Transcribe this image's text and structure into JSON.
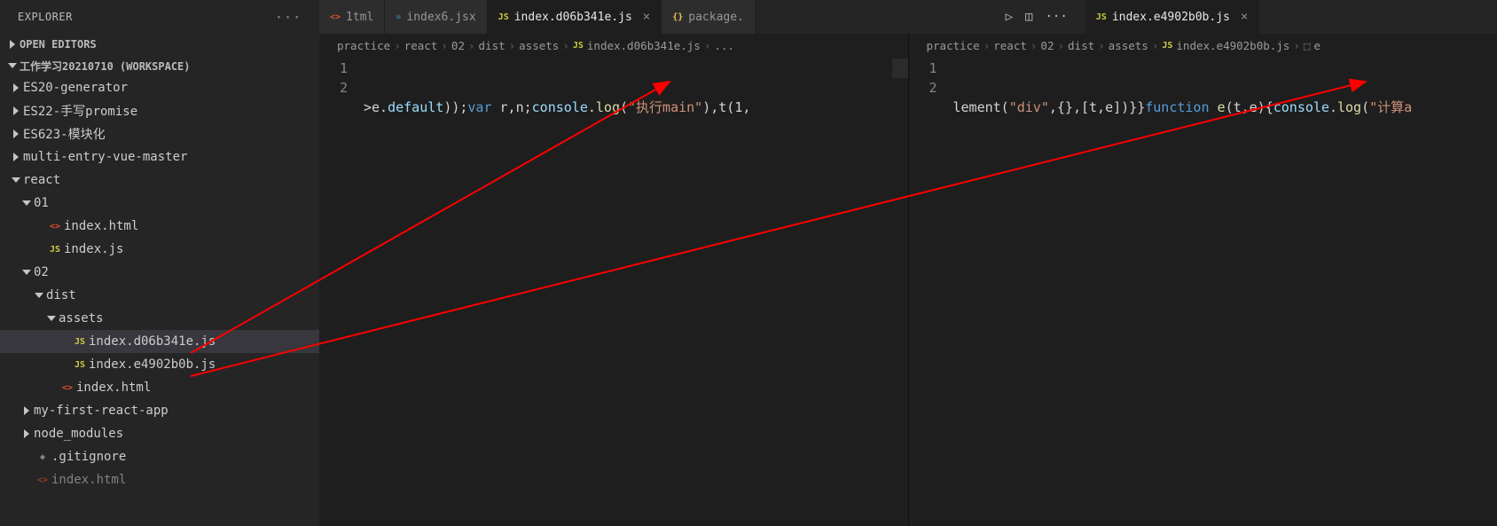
{
  "explorer": {
    "title": "EXPLORER",
    "sections": {
      "open_editors": "OPEN EDITORS",
      "workspace": "工作学习20210710 (WORKSPACE)"
    },
    "tree": [
      {
        "kind": "folder",
        "depth": 1,
        "open": false,
        "label": "ES20-generator"
      },
      {
        "kind": "folder",
        "depth": 1,
        "open": false,
        "label": "ES22-手写promise"
      },
      {
        "kind": "folder",
        "depth": 1,
        "open": false,
        "label": "ES623-模块化"
      },
      {
        "kind": "folder",
        "depth": 1,
        "open": false,
        "label": "multi-entry-vue-master"
      },
      {
        "kind": "folder",
        "depth": 1,
        "open": true,
        "label": "react"
      },
      {
        "kind": "folder",
        "depth": 2,
        "open": true,
        "label": "01"
      },
      {
        "kind": "file",
        "depth": 3,
        "icon": "html",
        "label": "index.html"
      },
      {
        "kind": "file",
        "depth": 3,
        "icon": "js",
        "label": "index.js"
      },
      {
        "kind": "folder",
        "depth": 2,
        "open": true,
        "label": "02"
      },
      {
        "kind": "folder",
        "depth": 3,
        "open": true,
        "label": "dist"
      },
      {
        "kind": "folder",
        "depth": 4,
        "open": true,
        "label": "assets"
      },
      {
        "kind": "file",
        "depth": 5,
        "icon": "js",
        "label": "index.d06b341e.js",
        "selected": true
      },
      {
        "kind": "file",
        "depth": 5,
        "icon": "js",
        "label": "index.e4902b0b.js"
      },
      {
        "kind": "file",
        "depth": 4,
        "icon": "html",
        "label": "index.html"
      },
      {
        "kind": "folder",
        "depth": 2,
        "open": false,
        "label": "my-first-react-app"
      },
      {
        "kind": "folder",
        "depth": 2,
        "open": false,
        "label": "node_modules"
      },
      {
        "kind": "file",
        "depth": 2,
        "icon": "git",
        "label": ".gitignore"
      },
      {
        "kind": "file",
        "depth": 2,
        "icon": "html",
        "label": "index.html",
        "dim": true
      }
    ]
  },
  "tabs": [
    {
      "icon": "html",
      "label": "1tml",
      "active": false,
      "close": false
    },
    {
      "icon": "react",
      "label": "index6.jsx",
      "active": false,
      "close": false
    },
    {
      "icon": "js",
      "label": "index.d06b341e.js",
      "active": true,
      "close": true
    },
    {
      "icon": "json",
      "label": "package.",
      "active": false,
      "close": false
    }
  ],
  "actions": {
    "run": "▷",
    "split": "◫",
    "more": "···"
  },
  "paneLeft": {
    "tab": {
      "icon": "js",
      "label": "index.d06b341e.js"
    },
    "breadcrumbs": [
      "practice",
      "react",
      "02",
      "dist",
      "assets"
    ],
    "bcfile": "index.d06b341e.js",
    "bcextra": "...",
    "lines": [
      "1",
      "2"
    ],
    "code": [
      {
        "pre": ">e.",
        "p1": "default",
        "mid": "));",
        "kw": "var",
        "mid2": " r,n;",
        "p2": "console",
        "dot": ".",
        "fn": "log",
        "open": "(",
        "str": "\"执行main\"",
        "rest": "),t(1,"
      },
      {
        "blank": true
      }
    ]
  },
  "paneRight": {
    "tab": {
      "icon": "js",
      "label": "index.e4902b0b.js"
    },
    "breadcrumbs": [
      "practice",
      "react",
      "02",
      "dist",
      "assets"
    ],
    "bcfile": "index.e4902b0b.js",
    "bcextra_icon": "cube",
    "bcextra": "e",
    "lines": [
      "1",
      "2"
    ],
    "code": [
      {
        "pre": "lement(",
        "str1": "\"div\"",
        "mid": ",{},[t,e])}}",
        "kw": "function",
        "sp": " ",
        "fn": "e",
        "args": "(t,e){",
        "p2": "console",
        "dot": ".",
        "fn2": "log",
        "open": "(",
        "str2": "\"计算a",
        "rest": ""
      },
      {
        "blank": true
      }
    ]
  }
}
